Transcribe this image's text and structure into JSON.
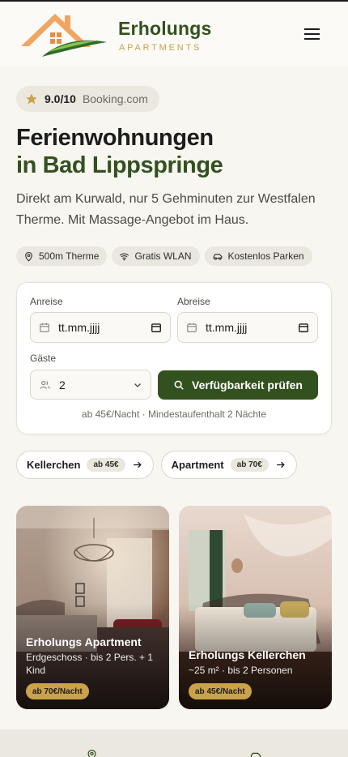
{
  "brand": {
    "name": "Erholungs",
    "subtitle": "APARTMENTS"
  },
  "rating": {
    "score": "9.0/10",
    "source": "Booking.com"
  },
  "hero": {
    "title_line1": "Ferienwohnungen",
    "title_line2": "in Bad Lippspringe",
    "lead": "Direkt am Kurwald, nur 5 Gehminuten zur Westfalen Therme. Mit Massage-Angebot im Haus."
  },
  "features": [
    {
      "icon": "location-pin-icon",
      "label": "500m Therme"
    },
    {
      "icon": "wifi-icon",
      "label": "Gratis WLAN"
    },
    {
      "icon": "car-icon",
      "label": "Kostenlos Parken"
    }
  ],
  "booking": {
    "arrival_label": "Anreise",
    "arrival_value": "tt.mm.jjjj",
    "departure_label": "Abreise",
    "departure_value": "tt.mm.jjjj",
    "guests_label": "Gäste",
    "guests_value": "2",
    "cta_label": "Verfügbarkeit prüfen",
    "note": "ab 45€/Nacht · Mindestaufenthalt 2 Nächte"
  },
  "quick_links": [
    {
      "label": "Kellerchen",
      "price": "ab 45€"
    },
    {
      "label": "Apartment",
      "price": "ab 70€"
    }
  ],
  "apartments": [
    {
      "title": "Erholungs Apartment",
      "desc": "Erdgeschoss · bis 2 Pers. + 1 Kind",
      "price": "ab 70€/Nacht"
    },
    {
      "title": "Erholungs Kellerchen",
      "desc": "~25 m² · bis 2 Personen",
      "price": "ab 45€/Nacht"
    }
  ],
  "colors": {
    "brand_green": "#33501f",
    "accent_gold": "#c9a24a",
    "star": "#c9a24a",
    "background": "#f7f6f0"
  }
}
